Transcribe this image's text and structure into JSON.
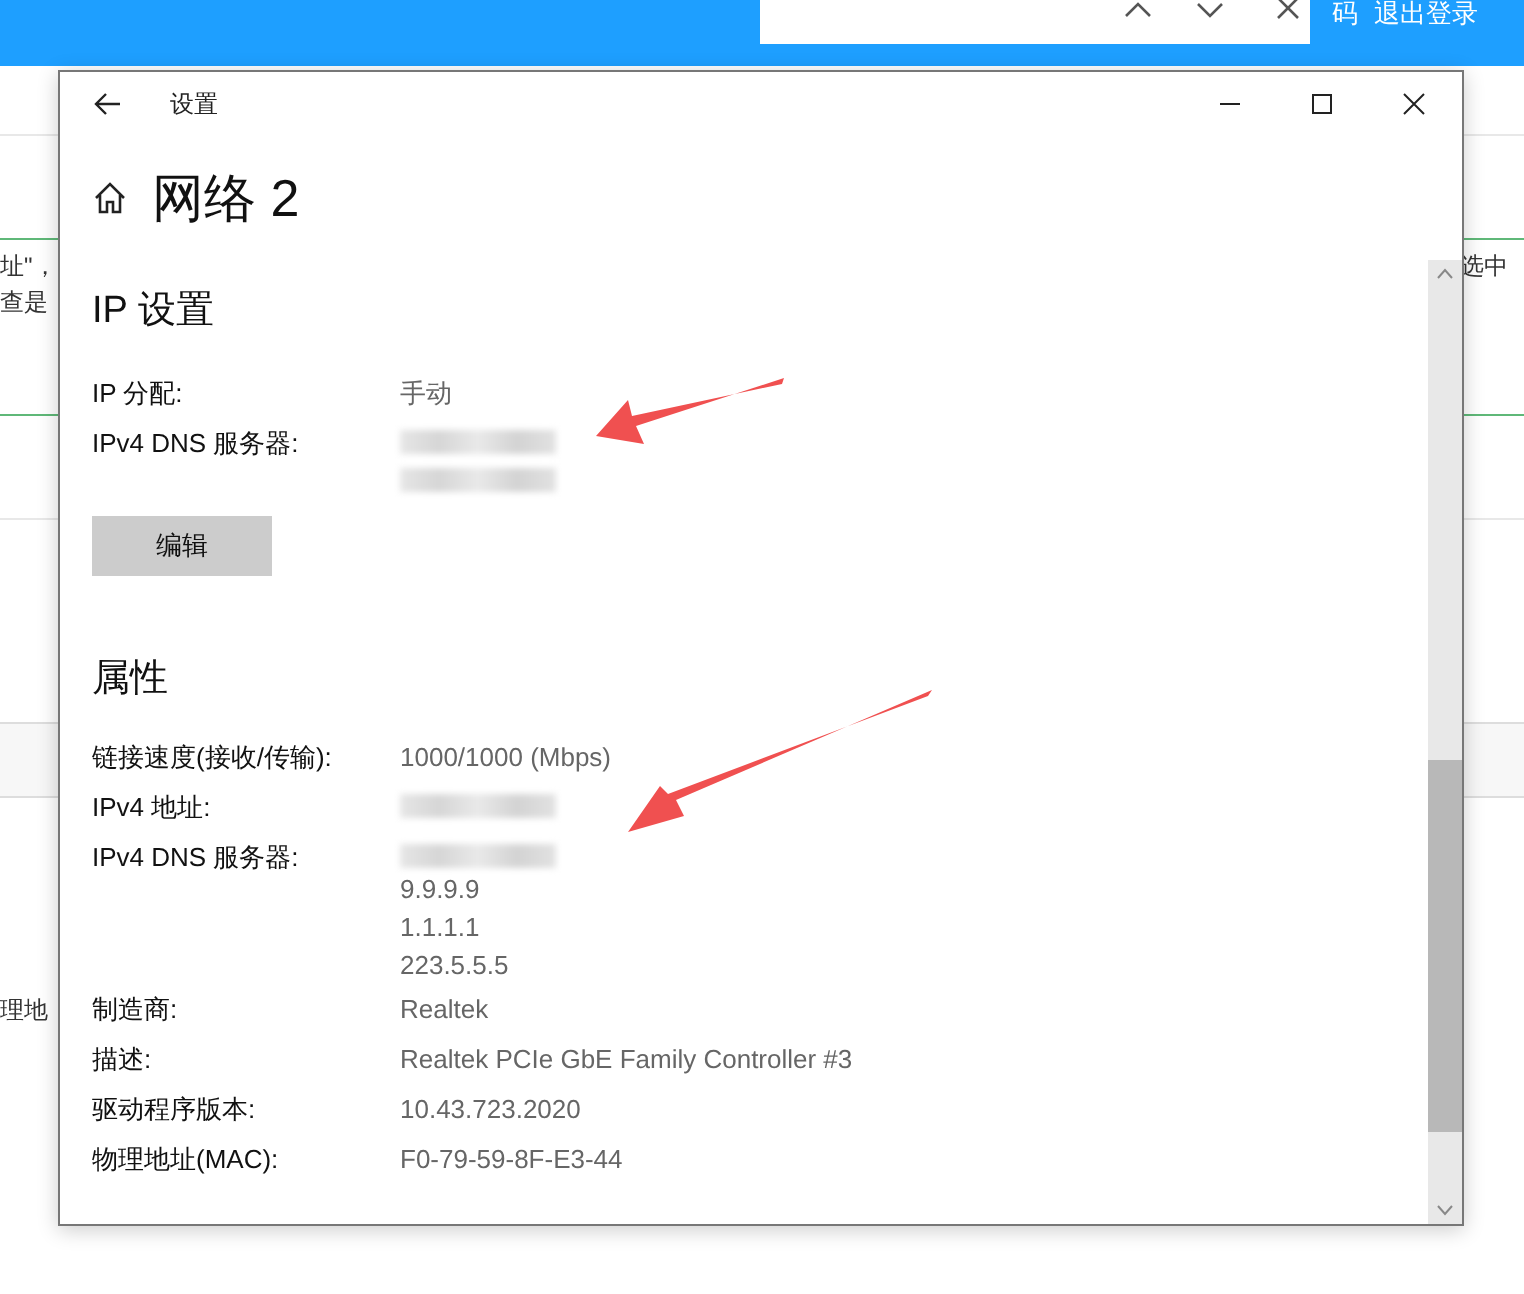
{
  "background_page": {
    "header_links": [
      {
        "text": "码"
      },
      {
        "text": "退出登录"
      }
    ],
    "left_fragments": [
      "址\"，",
      "查是",
      "理地"
    ],
    "right_fragments": [
      "选中"
    ]
  },
  "window": {
    "title": "设置",
    "page_title": "网络 2",
    "sections": [
      {
        "heading": "IP 设置",
        "rows": [
          {
            "label": "IP 分配:",
            "values": [
              {
                "kind": "text",
                "text": "手动"
              }
            ]
          },
          {
            "label": "IPv4 DNS 服务器:",
            "values": [
              {
                "kind": "redacted"
              },
              {
                "kind": "redacted"
              }
            ]
          }
        ],
        "button": "编辑"
      },
      {
        "heading": "属性",
        "rows": [
          {
            "label": "链接速度(接收/传输):",
            "values": [
              {
                "kind": "text",
                "text": "1000/1000 (Mbps)"
              }
            ]
          },
          {
            "label": "IPv4 地址:",
            "values": [
              {
                "kind": "redacted"
              }
            ]
          },
          {
            "label": "IPv4 DNS 服务器:",
            "values": [
              {
                "kind": "redacted"
              },
              {
                "kind": "text",
                "text": "9.9.9.9"
              },
              {
                "kind": "text",
                "text": "1.1.1.1"
              },
              {
                "kind": "text",
                "text": "223.5.5.5"
              }
            ]
          },
          {
            "label": "制造商:",
            "values": [
              {
                "kind": "text",
                "text": "Realtek"
              }
            ]
          },
          {
            "label": "描述:",
            "values": [
              {
                "kind": "text",
                "text": "Realtek PCIe GbE Family Controller #3"
              }
            ]
          },
          {
            "label": "驱动程序版本:",
            "values": [
              {
                "kind": "text",
                "text": "10.43.723.2020"
              }
            ]
          },
          {
            "label": "物理地址(MAC):",
            "values": [
              {
                "kind": "text",
                "text": "F0-79-59-8F-E3-44"
              }
            ]
          }
        ]
      }
    ]
  }
}
